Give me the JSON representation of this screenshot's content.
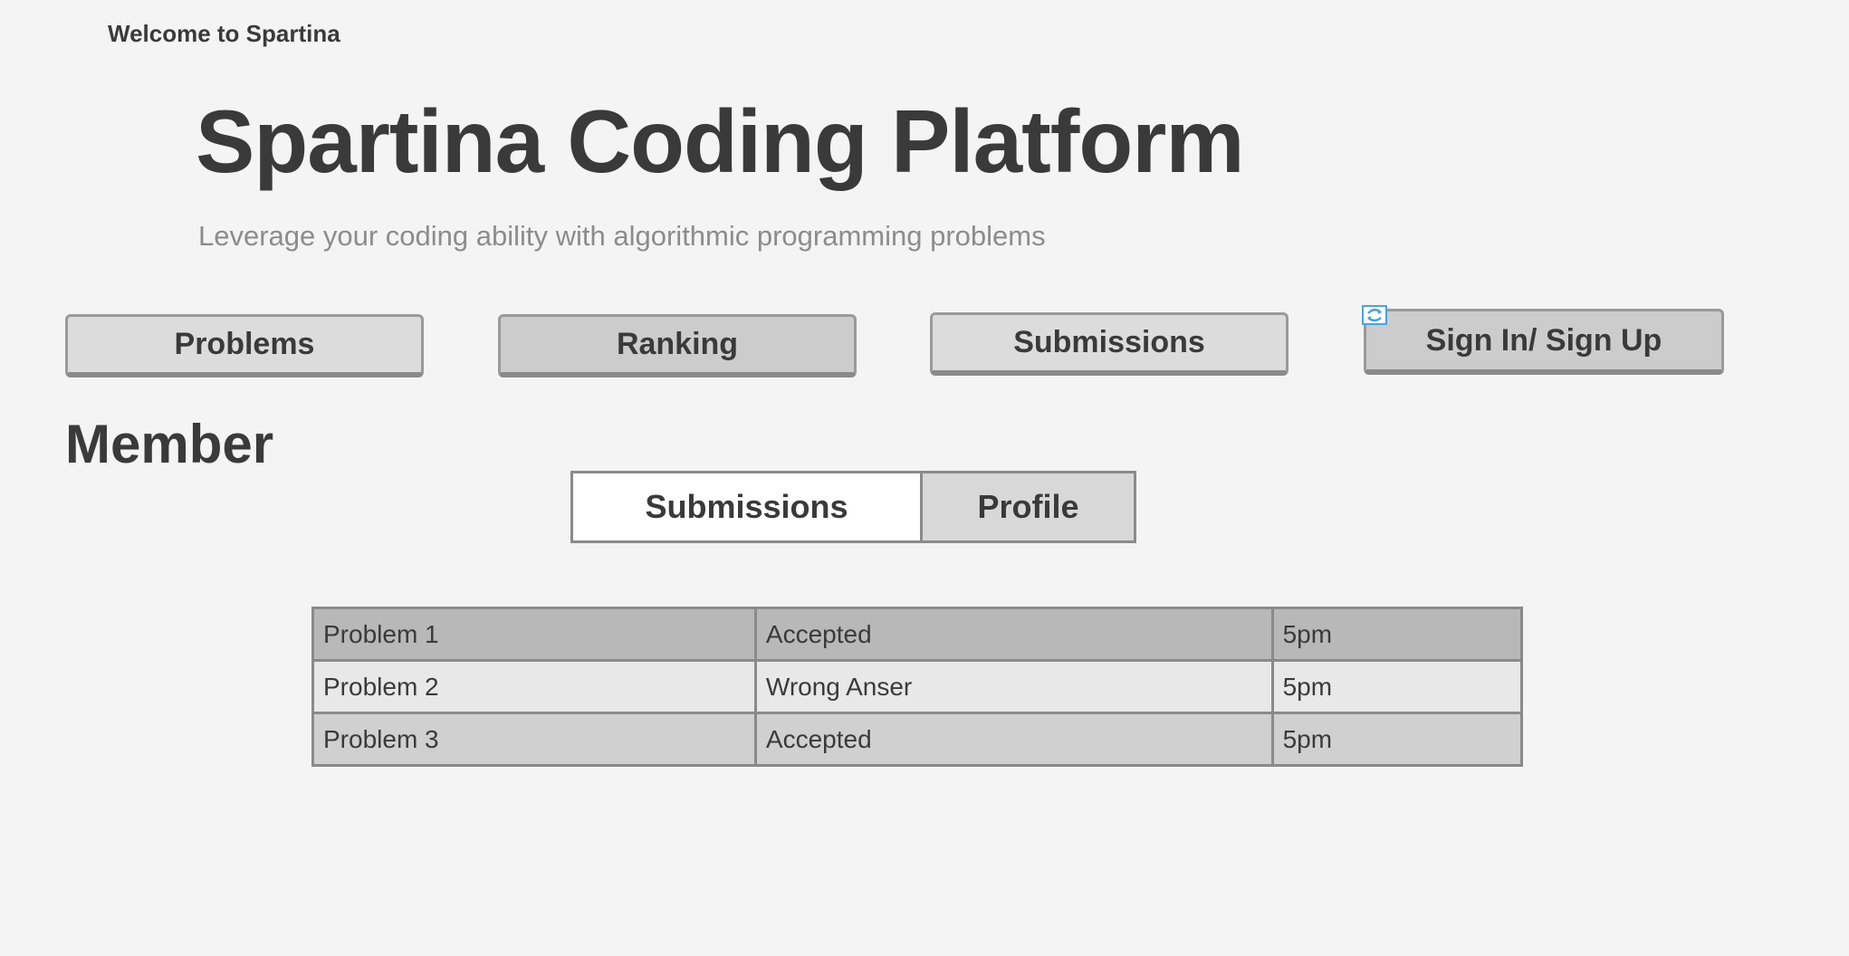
{
  "header": {
    "welcome": "Welcome to Spartina",
    "title": "Spartina Coding Platform",
    "subtitle": "Leverage your coding ability with algorithmic programming problems"
  },
  "nav": {
    "problems": "Problems",
    "ranking": "Ranking",
    "submissions": "Submissions",
    "signin": "Sign In/ Sign Up",
    "signin_icon": "refresh-icon"
  },
  "member": {
    "heading": "Member",
    "tabs": [
      {
        "label": "Submissions",
        "active": true
      },
      {
        "label": "Profile",
        "active": false
      }
    ]
  },
  "submissions_table": {
    "rows": [
      {
        "problem": "Problem 1",
        "status": "Accepted",
        "time": "5pm"
      },
      {
        "problem": "Problem 2",
        "status": "Wrong Anser",
        "time": "5pm"
      },
      {
        "problem": "Problem 3",
        "status": "Accepted",
        "time": "5pm"
      }
    ]
  },
  "colors": {
    "background": "#f4f4f4",
    "text": "#3a3a3a",
    "subtitle": "#8c8c8c",
    "icon_accent": "#4aa3df"
  }
}
